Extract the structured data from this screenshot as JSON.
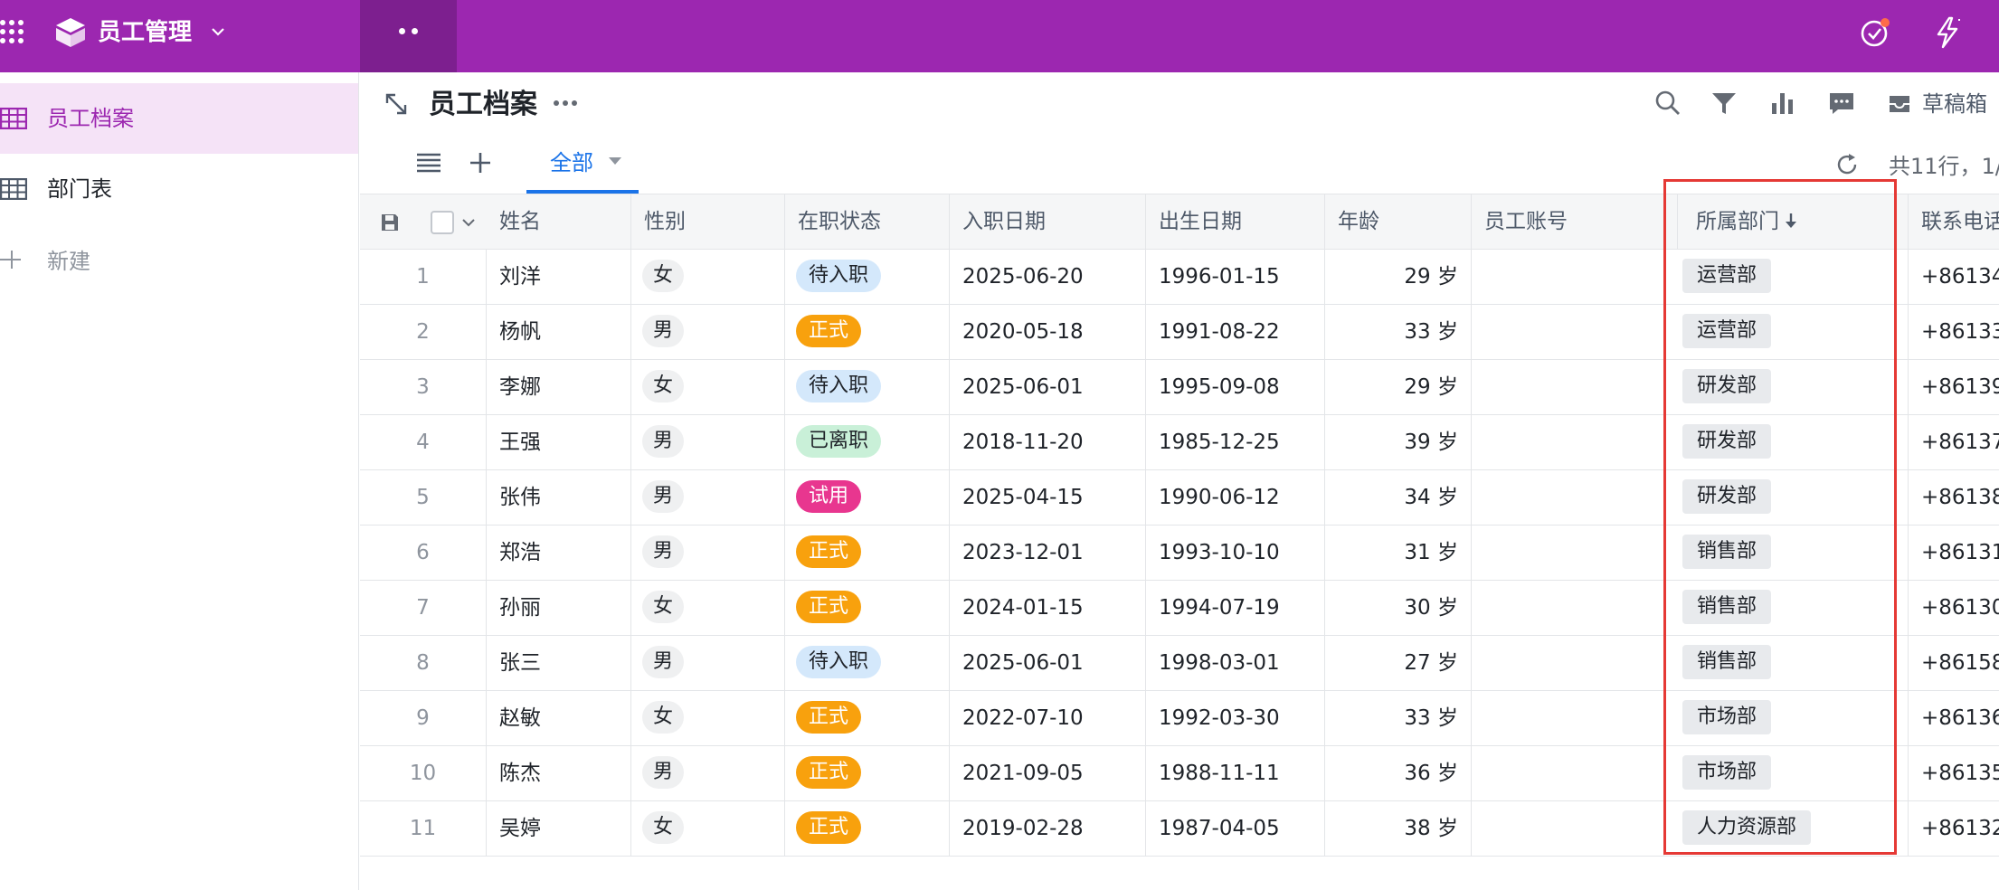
{
  "app": {
    "title": "员工管理",
    "colors": {
      "brand": "#9c27b0",
      "brand_dark": "#7d1f8f",
      "accent": "#1a73e8",
      "highlight": "#e53935"
    }
  },
  "sidebar": {
    "items": [
      {
        "label": "员工档案",
        "icon": "table-icon",
        "active": true
      },
      {
        "label": "部门表",
        "icon": "table-icon",
        "active": false
      }
    ],
    "new_label": "新建"
  },
  "header": {
    "title": "员工档案",
    "draft_label": "草稿箱",
    "icons": [
      "search-icon",
      "filter-icon",
      "chart-icon",
      "comment-icon",
      "inbox-icon"
    ]
  },
  "views": {
    "active_tab": "全部",
    "row_count": "共11行，1/"
  },
  "table": {
    "columns": [
      "姓名",
      "性别",
      "在职状态",
      "入职日期",
      "出生日期",
      "年龄",
      "员工账号",
      "所属部门",
      "联系电话"
    ],
    "status_colors": {
      "待入职": {
        "bg": "#d4e8fb",
        "fg": "#1f2329"
      },
      "正式": {
        "bg": "#f8a10d",
        "fg": "#ffffff"
      },
      "已离职": {
        "bg": "#c9f0d8",
        "fg": "#1f2329"
      },
      "试用": {
        "bg": "#e8368f",
        "fg": "#ffffff"
      }
    },
    "rows": [
      {
        "idx": "1",
        "name": "刘洋",
        "gender": "女",
        "status": "待入职",
        "hire": "2025-06-20",
        "birth": "1996-01-15",
        "age": "29 岁",
        "account": "",
        "dept": "运营部",
        "phone": "+86134"
      },
      {
        "idx": "2",
        "name": "杨帆",
        "gender": "男",
        "status": "正式",
        "hire": "2020-05-18",
        "birth": "1991-08-22",
        "age": "33 岁",
        "account": "",
        "dept": "运营部",
        "phone": "+86133"
      },
      {
        "idx": "3",
        "name": "李娜",
        "gender": "女",
        "status": "待入职",
        "hire": "2025-06-01",
        "birth": "1995-09-08",
        "age": "29 岁",
        "account": "",
        "dept": "研发部",
        "phone": "+86139"
      },
      {
        "idx": "4",
        "name": "王强",
        "gender": "男",
        "status": "已离职",
        "hire": "2018-11-20",
        "birth": "1985-12-25",
        "age": "39 岁",
        "account": "",
        "dept": "研发部",
        "phone": "+86137"
      },
      {
        "idx": "5",
        "name": "张伟",
        "gender": "男",
        "status": "试用",
        "hire": "2025-04-15",
        "birth": "1990-06-12",
        "age": "34 岁",
        "account": "",
        "dept": "研发部",
        "phone": "+86138"
      },
      {
        "idx": "6",
        "name": "郑浩",
        "gender": "男",
        "status": "正式",
        "hire": "2023-12-01",
        "birth": "1993-10-10",
        "age": "31 岁",
        "account": "",
        "dept": "销售部",
        "phone": "+86131"
      },
      {
        "idx": "7",
        "name": "孙丽",
        "gender": "女",
        "status": "正式",
        "hire": "2024-01-15",
        "birth": "1994-07-19",
        "age": "30 岁",
        "account": "",
        "dept": "销售部",
        "phone": "+86130"
      },
      {
        "idx": "8",
        "name": "张三",
        "gender": "男",
        "status": "待入职",
        "hire": "2025-06-01",
        "birth": "1998-03-01",
        "age": "27 岁",
        "account": "",
        "dept": "销售部",
        "phone": "+86158"
      },
      {
        "idx": "9",
        "name": "赵敏",
        "gender": "女",
        "status": "正式",
        "hire": "2022-07-10",
        "birth": "1992-03-30",
        "age": "33 岁",
        "account": "",
        "dept": "市场部",
        "phone": "+86136"
      },
      {
        "idx": "10",
        "name": "陈杰",
        "gender": "男",
        "status": "正式",
        "hire": "2021-09-05",
        "birth": "1988-11-11",
        "age": "36 岁",
        "account": "",
        "dept": "市场部",
        "phone": "+86135"
      },
      {
        "idx": "11",
        "name": "吴婷",
        "gender": "女",
        "status": "正式",
        "hire": "2019-02-28",
        "birth": "1987-04-05",
        "age": "38 岁",
        "account": "",
        "dept": "人力资源部",
        "phone": "+86132"
      }
    ]
  }
}
